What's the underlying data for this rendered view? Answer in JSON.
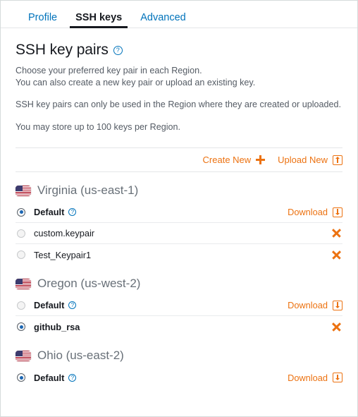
{
  "tabs": [
    {
      "label": "Profile",
      "active": false
    },
    {
      "label": "SSH keys",
      "active": true
    },
    {
      "label": "Advanced",
      "active": false
    }
  ],
  "header": {
    "title": "SSH key pairs",
    "help_icon": "question-circle-icon",
    "description_line1": "Choose your preferred key pair in each Region.",
    "description_line2": "You can also create a new key pair or upload an existing key.",
    "note1": "SSH key pairs can only be used in the Region where they are created or uploaded.",
    "note2": "You may store up to 100 keys per Region."
  },
  "actions": {
    "create_label": "Create New",
    "create_icon": "plus-icon",
    "upload_label": "Upload New",
    "upload_icon": "upload-box-icon"
  },
  "icons": {
    "download": "download-box-icon",
    "delete": "x-icon",
    "flag": "us-flag-icon"
  },
  "colors": {
    "accent_orange": "#ec7211",
    "link_blue": "#0073bb",
    "text_dark": "#16191f",
    "text_muted": "#545b64",
    "region_gray": "#687078",
    "radio_blue": "#1b66b3",
    "divider": "#e9ebed"
  },
  "regions": [
    {
      "name": "Virginia (us-east-1)",
      "keys": [
        {
          "label": "Default",
          "selected": true,
          "has_help": true,
          "action": "download",
          "action_label": "Download"
        },
        {
          "label": "custom.keypair",
          "selected": false,
          "has_help": false,
          "action": "delete",
          "action_label": ""
        },
        {
          "label": "Test_Keypair1",
          "selected": false,
          "has_help": false,
          "action": "delete",
          "action_label": ""
        }
      ]
    },
    {
      "name": "Oregon (us-west-2)",
      "keys": [
        {
          "label": "Default",
          "selected": false,
          "has_help": true,
          "action": "download",
          "action_label": "Download"
        },
        {
          "label": "github_rsa",
          "selected": true,
          "has_help": false,
          "action": "delete",
          "action_label": ""
        }
      ]
    },
    {
      "name": "Ohio (us-east-2)",
      "keys": [
        {
          "label": "Default",
          "selected": true,
          "has_help": true,
          "action": "download",
          "action_label": "Download"
        }
      ]
    }
  ]
}
